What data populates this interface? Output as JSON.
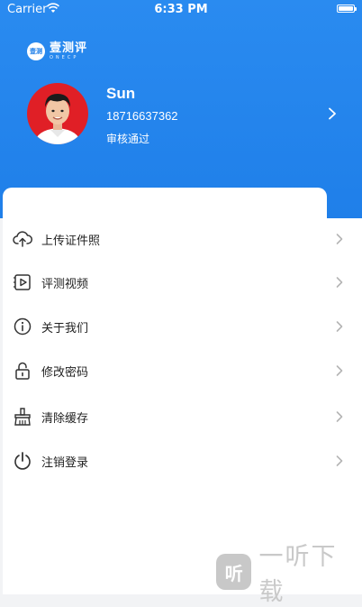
{
  "status_bar": {
    "carrier": "Carrier",
    "time": "6:33 PM"
  },
  "brand": {
    "badge": "壹测",
    "name": "壹测评",
    "sub": "ONECP"
  },
  "profile": {
    "name": "Sun",
    "phone": "18716637362",
    "status": "审核通过"
  },
  "menu": [
    {
      "label": "上传证件照",
      "icon": "cloud-upload-icon"
    },
    {
      "label": "评测视频",
      "icon": "video-play-icon"
    },
    {
      "label": "关于我们",
      "icon": "info-icon"
    },
    {
      "label": "修改密码",
      "icon": "lock-icon"
    },
    {
      "label": "清除缓存",
      "icon": "broom-icon"
    },
    {
      "label": "注销登录",
      "icon": "power-icon"
    }
  ],
  "watermark": {
    "logo": "听",
    "text": "一听下载"
  },
  "colors": {
    "primary": "#1f7fe9",
    "avatar_bg": "#e01f26",
    "text": "#222222",
    "chevron": "#b5b5b5"
  }
}
